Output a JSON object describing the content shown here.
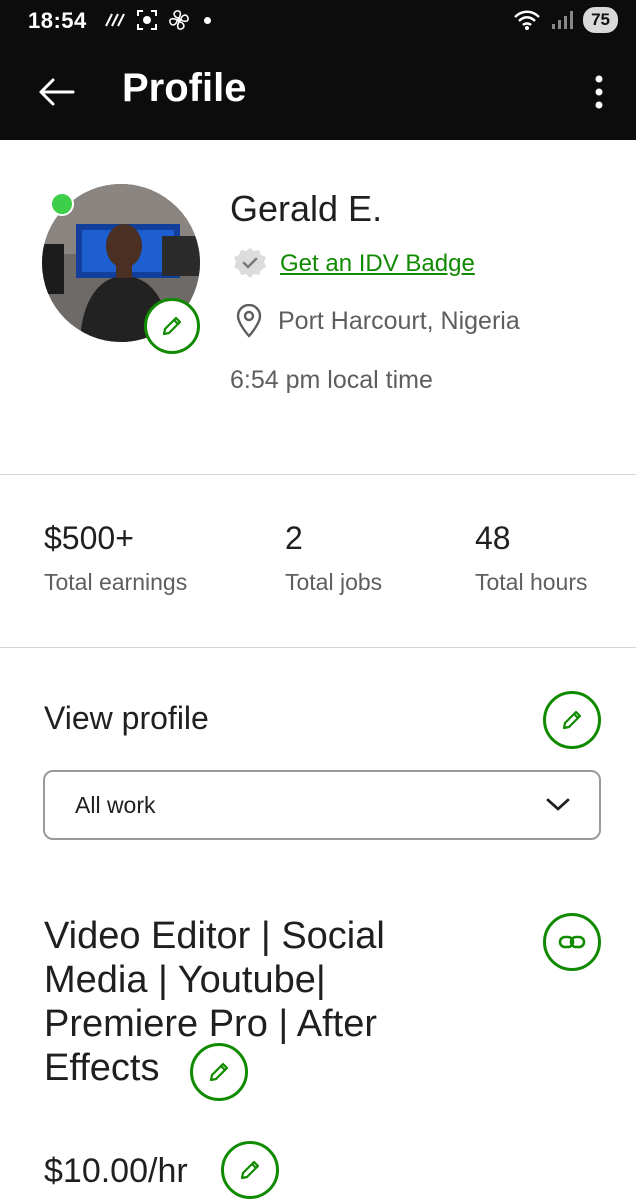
{
  "status_bar": {
    "time": "18:54",
    "battery": "75"
  },
  "app_bar": {
    "title": "Profile"
  },
  "profile": {
    "name": "Gerald E.",
    "idv_link": "Get an IDV Badge",
    "location": "Port Harcourt, Nigeria",
    "local_time": "6:54 pm local time",
    "online": true
  },
  "stats": [
    {
      "value": "$500+",
      "label": "Total earnings"
    },
    {
      "value": "2",
      "label": "Total jobs"
    },
    {
      "value": "48",
      "label": "Total hours"
    }
  ],
  "view_profile": {
    "title": "View profile",
    "select_value": "All work"
  },
  "work": {
    "title": "Video Editor | Social Media | Youtube| Premiere Pro | After Effects",
    "rate": "$10.00/hr"
  },
  "colors": {
    "brand_green": "#108a00",
    "online_green": "#3ecf4a",
    "header_bg": "#0c0c0c"
  },
  "icons": [
    "back-arrow-icon",
    "more-vertical-icon",
    "pencil-icon",
    "verified-badge-icon",
    "location-pin-icon",
    "chevron-down-icon",
    "link-icon",
    "wifi-icon",
    "signal-icon"
  ]
}
